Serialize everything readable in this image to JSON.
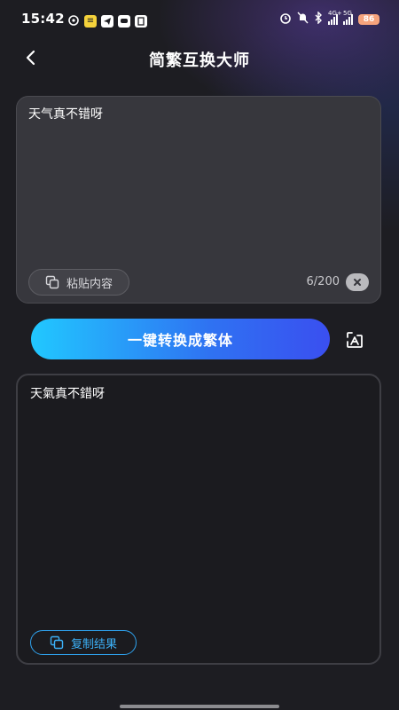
{
  "status_bar": {
    "time": "15:42",
    "network_1": "4G+",
    "network_2": "5G",
    "battery": "86"
  },
  "header": {
    "title": "简繁互换大师",
    "back_icon": "chevron-left-icon"
  },
  "input": {
    "text": "天气真不错呀",
    "paste_label": "粘贴内容",
    "char_count": "6/200",
    "clear_icon": "close-icon"
  },
  "convert": {
    "button_label": "一键转换成繁体",
    "swap_icon": "swap-icon"
  },
  "result": {
    "text": "天氣真不錯呀",
    "copy_label": "复制结果"
  },
  "colors": {
    "background": "#1d1d22",
    "card": "#37373d",
    "accent_start": "#21c8ff",
    "accent_end": "#3a4ff0",
    "copy_accent": "#3cb1f8"
  }
}
